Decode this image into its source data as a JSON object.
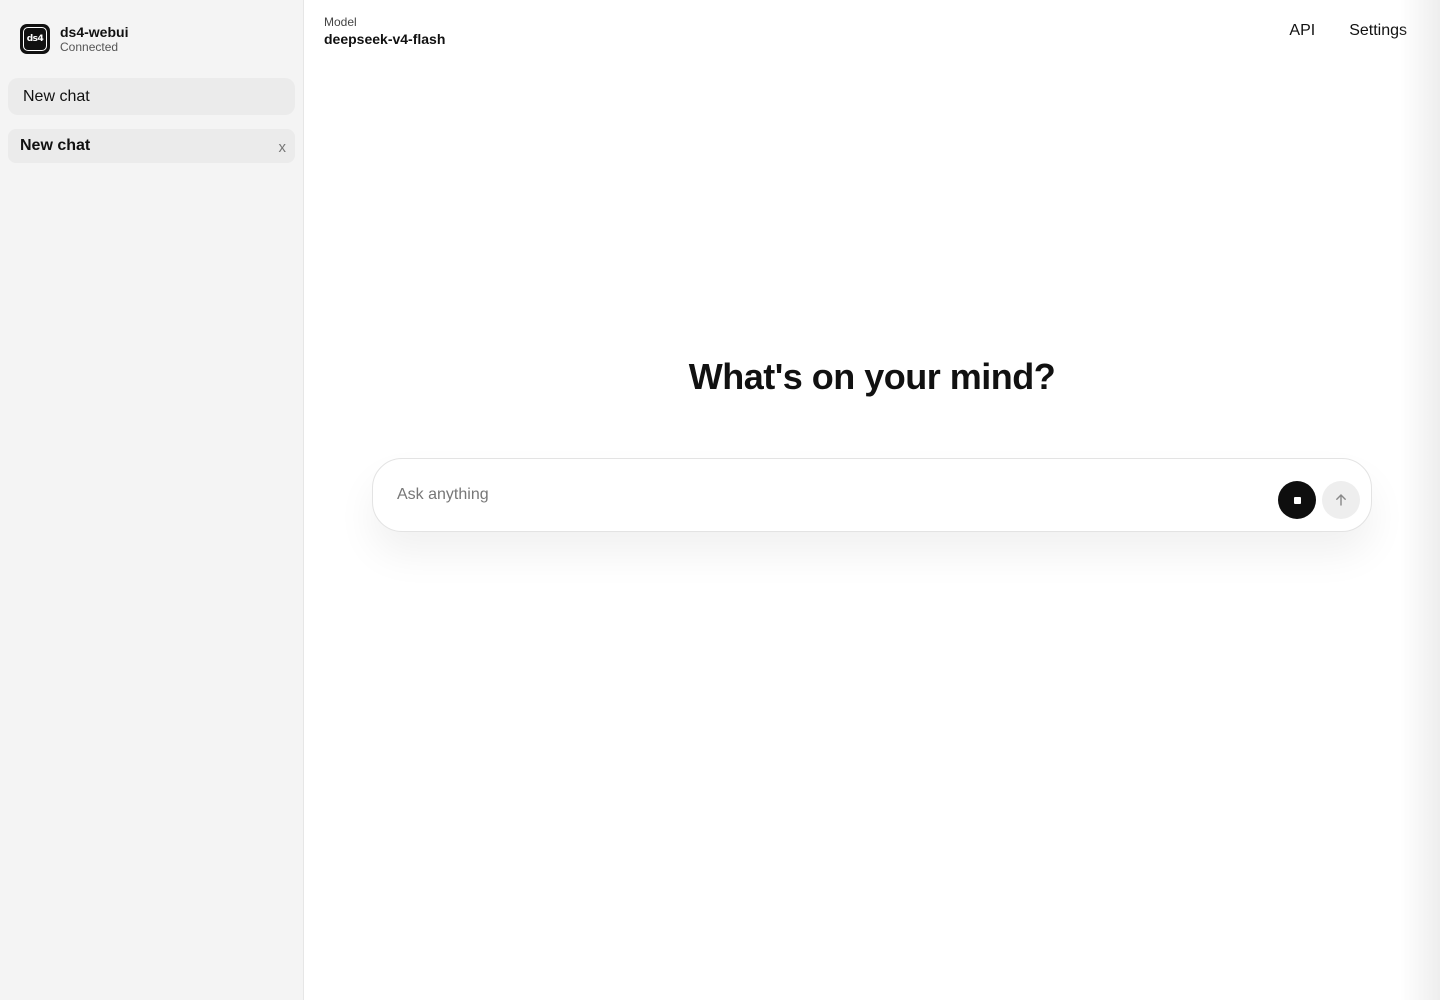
{
  "sidebar": {
    "brand": {
      "logo_text": "ds4",
      "name": "ds4-webui",
      "status": "Connected"
    },
    "new_chat_label": "New chat",
    "chats": [
      {
        "title": "New chat",
        "delete_label": "x"
      }
    ]
  },
  "header": {
    "model_label": "Model",
    "model_name": "deepseek-v4-flash",
    "links": [
      "API",
      "Settings"
    ]
  },
  "main": {
    "headline": "What's on your mind?",
    "composer": {
      "placeholder": "Ask anything",
      "value": "",
      "stop_icon": "stop-icon",
      "send_icon": "arrow-up-icon"
    }
  },
  "colors": {
    "sidebar_bg": "#f4f4f4",
    "accent_dark": "#0e0e0e",
    "send_bg": "#eeeeee"
  }
}
